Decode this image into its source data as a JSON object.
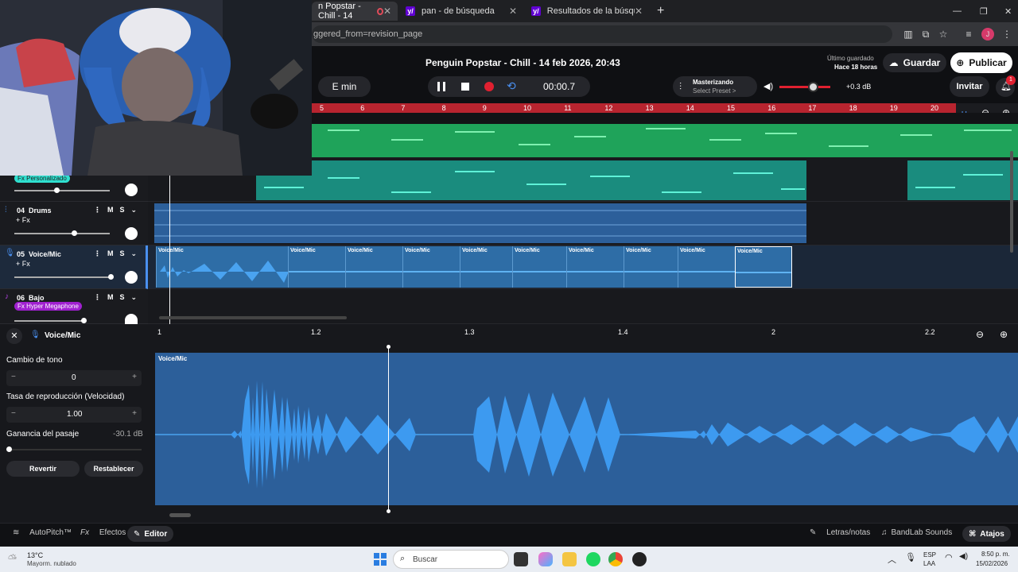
{
  "browser": {
    "tabs": [
      {
        "title": "n Popstar - Chill - 14"
      },
      {
        "title": "pan - de búsqueda"
      },
      {
        "title": "Resultados de la búsqueda de"
      }
    ],
    "url": "ggered_from=revision_page"
  },
  "header": {
    "project_title": "Penguin Popstar - Chill - 14 feb 2026, 20:43",
    "last_saved_label": "Último guardado",
    "last_saved_time": "Hace 18 horas",
    "save_label": "Guardar",
    "publish_label": "Publicar",
    "key_label": "E min",
    "time_display": "00:00.7",
    "mastering_label": "Masterizando",
    "mastering_preset": "Select Preset >",
    "volume_db": "+0.3 dB",
    "invite_label": "Invitar",
    "notif_count": "1",
    "accent_color": "#b8242f"
  },
  "ruler": {
    "numbers": [
      "5",
      "6",
      "7",
      "8",
      "9",
      "10",
      "11",
      "12",
      "13",
      "14",
      "15",
      "16",
      "17",
      "18",
      "19",
      "20"
    ]
  },
  "tracks": [
    {
      "fx_tag": "Fx Personalizado"
    },
    {
      "number": "04",
      "name": "Drums",
      "fx": "+ Fx",
      "mute": "M",
      "solo": "S"
    },
    {
      "number": "05",
      "name": "Voice/Mic",
      "fx": "+ Fx",
      "mute": "M",
      "solo": "S"
    },
    {
      "number": "06",
      "name": "Bajo",
      "fx_tag": "Fx Hyper Megaphone",
      "mute": "M",
      "solo": "S"
    }
  ],
  "voice_clip_label": "Voice/Mic",
  "editor": {
    "track_label": "Voice/Mic",
    "pitch_label": "Cambio de tono",
    "pitch_value": "0",
    "rate_label": "Tasa de reproducción (Velocidad)",
    "rate_value": "1.00",
    "gain_label": "Ganancia del pasaje",
    "gain_value": "-30.1 dB",
    "revert_label": "Revertir",
    "reset_label": "Restablecer",
    "ruler": [
      "1",
      "1.2",
      "1.3",
      "1.4",
      "2",
      "2.2"
    ],
    "clip_label": "Voice/Mic",
    "minus": "−",
    "plus": "+"
  },
  "bottom": {
    "autopitch": "AutoPitch™",
    "effects": "Efectos",
    "editor": "Editor",
    "lyrics": "Letras/notas",
    "sounds": "BandLab Sounds",
    "shortcuts": "Atajos"
  },
  "taskbar": {
    "weather_temp": "13°C",
    "weather_desc": "Mayorm. nublado",
    "search_placeholder": "Buscar",
    "lang1": "ESP",
    "lang2": "LAA",
    "time": "8:50 p. m.",
    "date": "15/02/2026"
  }
}
